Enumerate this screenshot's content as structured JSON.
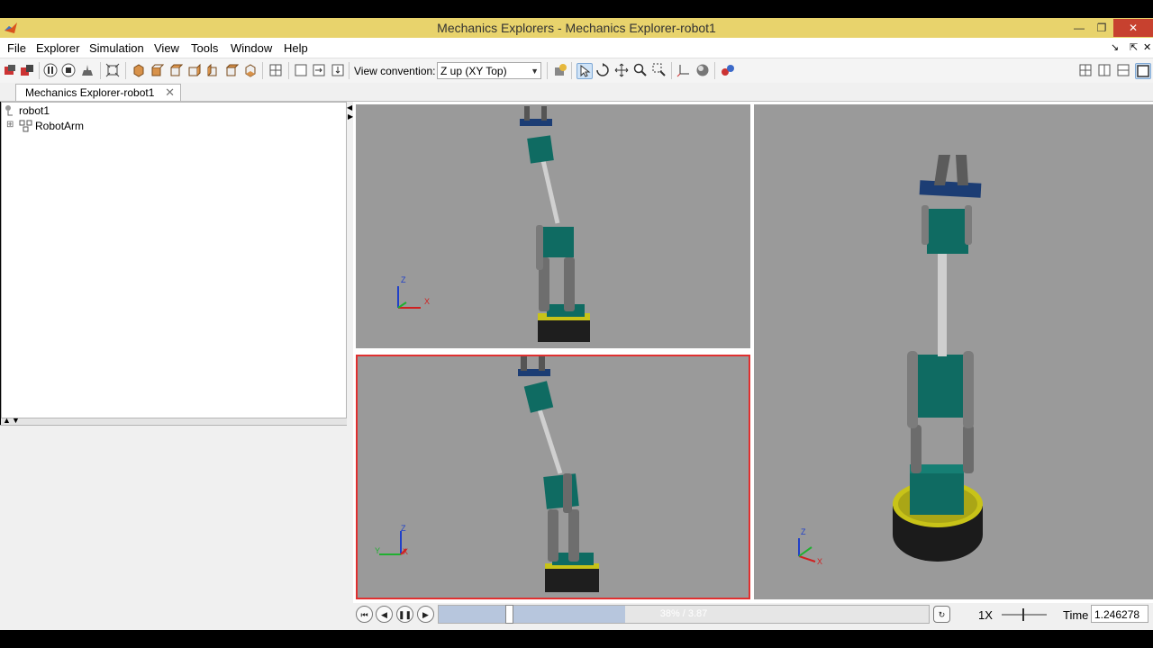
{
  "window": {
    "title": "Mechanics Explorers - Mechanics Explorer-robot1",
    "controls": [
      "minimize-icon",
      "restore-icon",
      "close-icon"
    ]
  },
  "menu": [
    "File",
    "Explorer",
    "Simulation",
    "View",
    "Tools",
    "Window",
    "Help"
  ],
  "toolbar": {
    "view_convention_label": "View convention:",
    "view_convention_value": "Z up (XY Top)"
  },
  "tab": {
    "label": "Mechanics Explorer-robot1"
  },
  "tree": {
    "root": "robot1",
    "children": [
      "RobotArm"
    ]
  },
  "axes": {
    "x": "X",
    "y": "Y",
    "z": "Z"
  },
  "playback": {
    "progress_text": "38% / 3.87",
    "progress_fraction": 0.38,
    "speed": "1X",
    "time_label": "Time",
    "time_value": "1.246278"
  },
  "colors": {
    "titlebar": "#e8d36c",
    "viewport_bg": "#9a9a9a",
    "selected_view_border": "#e03030",
    "link_teal": "#0f6b62",
    "gripper_blue": "#1c3d74",
    "base_yellow": "#c8c318"
  }
}
